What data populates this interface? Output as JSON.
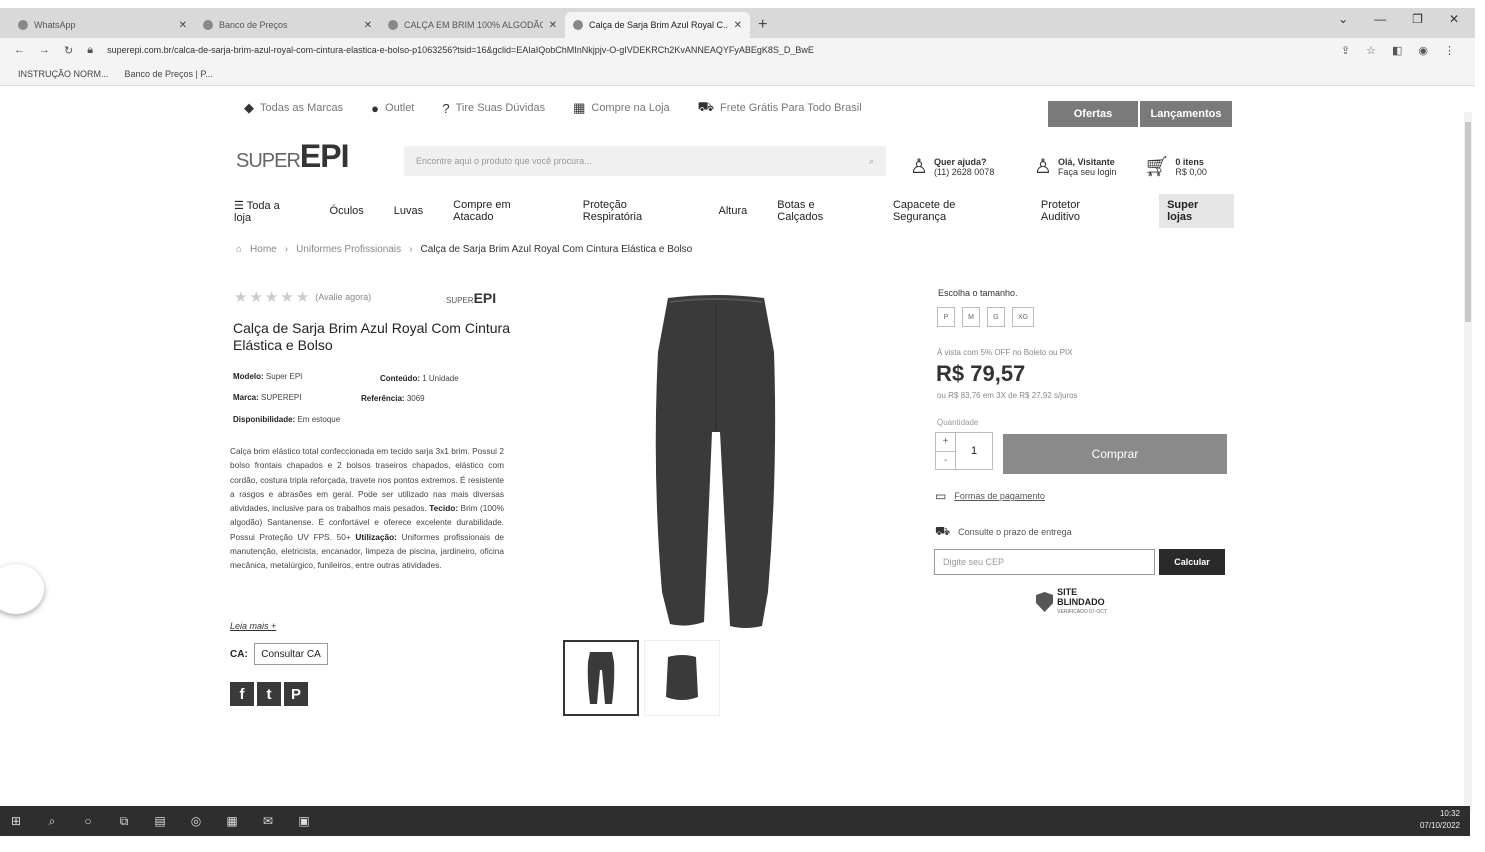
{
  "browser": {
    "tabs": [
      {
        "title": "WhatsApp",
        "active": false
      },
      {
        "title": "Banco de Preços",
        "active": false
      },
      {
        "title": "CALÇA EM BRIM 100% ALGODÃO",
        "active": false
      },
      {
        "title": "Calça de Sarja Brim Azul Royal C...",
        "active": true
      }
    ],
    "new_tab": "+",
    "url": "superepi.com.br/calca-de-sarja-brim-azul-royal-com-cintura-elastica-e-bolso-p1063256?tsid=16&gclid=EAIaIQobChMInNkjpjv-O-gIVDEKRCh2KvANNEAQYFyABEgK8S_D_BwE",
    "bookmarks": [
      "INSTRUÇÃO NORM...",
      "Banco de Preços | P..."
    ]
  },
  "topbar": {
    "items": [
      "Todas as Marcas",
      "Outlet",
      "Tire Suas Dúvidas",
      "Compre na Loja",
      "Frete Grátis Para Todo Brasil"
    ],
    "ofertas": "Ofertas",
    "lancamentos": "Lançamentos"
  },
  "header": {
    "logo_small": "SUPER",
    "logo_big": "EPI",
    "search_placeholder": "Encontre aqui o produto que você procura...",
    "help_title": "Quer ajuda?",
    "help_phone": "(11) 2628 0078",
    "user_title": "Olá, Visitante",
    "user_sub": "Faça seu login",
    "cart_title": "0 itens",
    "cart_value": "R$ 0,00"
  },
  "nav": {
    "items": [
      "☰ Toda a loja",
      "Óculos",
      "Luvas",
      "Compre em Atacado",
      "Proteção Respiratória",
      "Altura",
      "Botas e Calçados",
      "Capacete de Segurança",
      "Protetor Auditivo"
    ],
    "super_lojas": "Super lojas"
  },
  "breadcrumb": {
    "home": "Home",
    "category": "Uniformes Profissionais",
    "current": "Calça de Sarja Brim Azul Royal Com Cintura Elástica e Bolso"
  },
  "product": {
    "rate_text": "(Avalie agora)",
    "title": "Calça de Sarja Brim Azul Royal Com Cintura Elástica e Bolso",
    "modelo_label": "Modelo:",
    "modelo": "Super EPI",
    "conteudo_label": "Conteúdo:",
    "conteudo": "1 Unidade",
    "marca_label": "Marca:",
    "marca": "SUPEREPI",
    "referencia_label": "Referência:",
    "referencia": "3069",
    "disp_label": "Disponibilidade:",
    "disp": "Em estoque",
    "desc_part1": "Calça brim elástico total confeccionada em tecido sarja 3x1 brim. Possui 2 bolso frontais chapados e 2 bolsos traseiros chapados, elástico com cordão, costura tripla reforçada, travete nos pontos extremos. É resistente a rasgos e abrasões em geral. Pode ser utilizado nas mais diversas atividades, inclusive para os trabalhos mais pesados.",
    "tecido_label": "Tecido:",
    "desc_part2": "Brim (100% algodão) Santanense. É confortável e oferece excelente durabilidade. Possui Proteção UV FPS. 50+",
    "utilizacao_label": "Utilização:",
    "desc_part3": "Uniformes profissionais de manutenção, eletricista, encanador, limpeza de piscina, jardineiro, oficina mecânica, metalúrgico, funileiros, entre outras atividades.",
    "ler_mais": "Leia mais +",
    "ca_label": "CA:",
    "ca_button": "Consultar CA"
  },
  "buy": {
    "size_label": "Escolha o tamanho.",
    "sizes": [
      "P",
      "M",
      "G",
      "XG"
    ],
    "avista": "À vista com 5% OFF no Boleto ou PIX",
    "price": "R$ 79,57",
    "parcelas": "ou R$ 83,76 em 3X de R$ 27,92 s/juros",
    "qty_label": "Quantidade",
    "qty_value": "1",
    "comprar": "Comprar",
    "formas": "Formas de pagamento",
    "consulte": "Consulte o prazo de entrega",
    "cep_placeholder": "Digite seu CEP",
    "calcular": "Calcular",
    "blindado": "SITE BLINDADO",
    "blindado_sub": "VERIFICADO 07-OCT"
  },
  "taskbar": {
    "time": "10:32",
    "date": "07/10/2022"
  }
}
